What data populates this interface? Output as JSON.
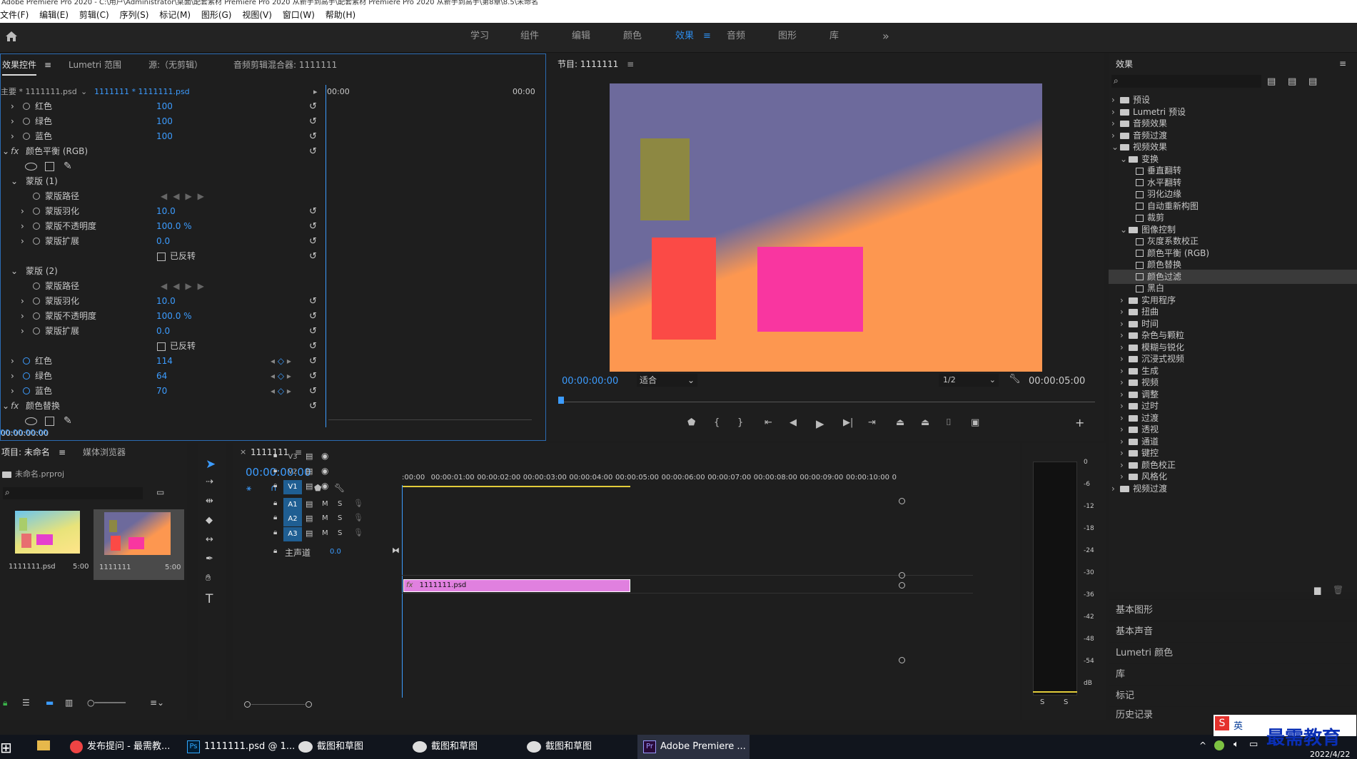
{
  "window": {
    "title": "Adobe Premiere Pro 2020 - C:\\用户\\Administrator\\桌面\\配套素材 Premiere Pro 2020 从新手到高手\\配套素材 Premiere Pro 2020 从新手到高手\\第8章\\8.5\\未命名"
  },
  "menu": [
    "文件(F)",
    "编辑(E)",
    "剪辑(C)",
    "序列(S)",
    "标记(M)",
    "图形(G)",
    "视图(V)",
    "窗口(W)",
    "帮助(H)"
  ],
  "workspaces": [
    "学习",
    "组件",
    "编辑",
    "颜色",
    "效果",
    "音频",
    "图形",
    "库"
  ],
  "active_workspace": "效果",
  "more_glyph": "»",
  "effect_controls": {
    "tabs": [
      "效果控件",
      "Lumetri 范围",
      "源:（无剪辑）",
      "音频剪辑混合器: 1111111"
    ],
    "master": "主要 * 1111111.psd",
    "clip": "1111111 * 1111111.psd",
    "ruler_start": "00:00",
    "ruler_end": "00:00",
    "rows": [
      {
        "label": "红色",
        "value": "100"
      },
      {
        "label": "绿色",
        "value": "100"
      },
      {
        "label": "蓝色",
        "value": "100"
      },
      {
        "label": "颜色平衡 (RGB)",
        "value": ""
      },
      {
        "label": "蒙版 (1)",
        "value": ""
      },
      {
        "label": "蒙版路径",
        "value": ""
      },
      {
        "label": "蒙版羽化",
        "value": "10.0"
      },
      {
        "label": "蒙版不透明度",
        "value": "100.0 %"
      },
      {
        "label": "蒙版扩展",
        "value": "0.0"
      },
      {
        "label": "已反转",
        "value": ""
      },
      {
        "label": "蒙版 (2)",
        "value": ""
      },
      {
        "label": "蒙版路径",
        "value": ""
      },
      {
        "label": "蒙版羽化",
        "value": "10.0"
      },
      {
        "label": "蒙版不透明度",
        "value": "100.0 %"
      },
      {
        "label": "蒙版扩展",
        "value": "0.0"
      },
      {
        "label": "已反转",
        "value": ""
      },
      {
        "label": "红色",
        "value": "114"
      },
      {
        "label": "绿色",
        "value": "64"
      },
      {
        "label": "蓝色",
        "value": "70"
      },
      {
        "label": "颜色替换",
        "value": ""
      }
    ],
    "timecode": "00:00:00:00"
  },
  "program": {
    "title": "节目: 1111111",
    "timecode": "00:00:00:00",
    "fit": "适合",
    "resolution": "1/2",
    "duration": "00:00:05:00",
    "colors": {
      "gradient_a": "#6d6a9c",
      "gradient_b": "#fd9750",
      "olive": "#8d8842",
      "red": "#fb4a46",
      "pink": "#f936a0"
    }
  },
  "effects_panel": {
    "title": "效果",
    "tree": [
      {
        "label": "预设",
        "indent": 0,
        "kind": "folder"
      },
      {
        "label": "Lumetri 预设",
        "indent": 0,
        "kind": "folder"
      },
      {
        "label": "音频效果",
        "indent": 0,
        "kind": "folder"
      },
      {
        "label": "音频过渡",
        "indent": 0,
        "kind": "folder"
      },
      {
        "label": "视频效果",
        "indent": 0,
        "kind": "folder",
        "open": true
      },
      {
        "label": "变换",
        "indent": 1,
        "kind": "folder",
        "open": true
      },
      {
        "label": "垂直翻转",
        "indent": 2,
        "kind": "fx"
      },
      {
        "label": "水平翻转",
        "indent": 2,
        "kind": "fx"
      },
      {
        "label": "羽化边缘",
        "indent": 2,
        "kind": "fx"
      },
      {
        "label": "自动重新构图",
        "indent": 2,
        "kind": "fx"
      },
      {
        "label": "裁剪",
        "indent": 2,
        "kind": "fx"
      },
      {
        "label": "图像控制",
        "indent": 1,
        "kind": "folder",
        "open": true
      },
      {
        "label": "灰度系数校正",
        "indent": 2,
        "kind": "fx"
      },
      {
        "label": "颜色平衡 (RGB)",
        "indent": 2,
        "kind": "fx"
      },
      {
        "label": "颜色替换",
        "indent": 2,
        "kind": "fx"
      },
      {
        "label": "颜色过滤",
        "indent": 2,
        "kind": "fx",
        "selected": true
      },
      {
        "label": "黑白",
        "indent": 2,
        "kind": "fx"
      },
      {
        "label": "实用程序",
        "indent": 1,
        "kind": "folder"
      },
      {
        "label": "扭曲",
        "indent": 1,
        "kind": "folder"
      },
      {
        "label": "时间",
        "indent": 1,
        "kind": "folder"
      },
      {
        "label": "杂色与颗粒",
        "indent": 1,
        "kind": "folder"
      },
      {
        "label": "模糊与锐化",
        "indent": 1,
        "kind": "folder"
      },
      {
        "label": "沉浸式视频",
        "indent": 1,
        "kind": "folder"
      },
      {
        "label": "生成",
        "indent": 1,
        "kind": "folder"
      },
      {
        "label": "视频",
        "indent": 1,
        "kind": "folder"
      },
      {
        "label": "调整",
        "indent": 1,
        "kind": "folder"
      },
      {
        "label": "过时",
        "indent": 1,
        "kind": "folder"
      },
      {
        "label": "过渡",
        "indent": 1,
        "kind": "folder"
      },
      {
        "label": "透视",
        "indent": 1,
        "kind": "folder"
      },
      {
        "label": "通道",
        "indent": 1,
        "kind": "folder"
      },
      {
        "label": "键控",
        "indent": 1,
        "kind": "folder"
      },
      {
        "label": "颜色校正",
        "indent": 1,
        "kind": "folder"
      },
      {
        "label": "风格化",
        "indent": 1,
        "kind": "folder"
      },
      {
        "label": "视频过渡",
        "indent": 0,
        "kind": "folder"
      }
    ],
    "sections": [
      "基本图形",
      "基本声音",
      "Lumetri 颜色",
      "库",
      "标记",
      "历史记录"
    ]
  },
  "project": {
    "tabs": [
      "项目: 未命名",
      "媒体浏览器"
    ],
    "file": "未命名.prproj",
    "items": [
      {
        "name": "1111111.psd",
        "dur": "5:00"
      },
      {
        "name": "1111111",
        "dur": "5:00"
      }
    ]
  },
  "timeline": {
    "tab": "1111111",
    "timecode": "00:00:00:00",
    "ruler": [
      ":00:00",
      "00:00:01:00",
      "00:00:02:00",
      "00:00:03:00",
      "00:00:04:00",
      "00:00:05:00",
      "00:00:06:00",
      "00:00:07:00",
      "00:00:08:00",
      "00:00:09:00",
      "00:00:10:00",
      "0"
    ],
    "tracks": [
      "V3",
      "V2",
      "V1",
      "A1",
      "A2",
      "A3"
    ],
    "master": "主声道",
    "master_val": "0.0",
    "clip": "1111111.psd"
  },
  "meter": {
    "scale": [
      "0",
      "-6",
      "-12",
      "-18",
      "-24",
      "-30",
      "-36",
      "-42",
      "-48",
      "-54",
      "dB"
    ],
    "s_labels": [
      "S",
      "S"
    ]
  },
  "taskbar": {
    "items": [
      "发布提问 - 最需教...",
      "1111111.psd @ 1...",
      "截图和草图",
      "截图和草图",
      "截图和草图",
      "Adobe Premiere ..."
    ],
    "ime": "英",
    "date": "2022/4/22",
    "watermark": "最需教育"
  }
}
